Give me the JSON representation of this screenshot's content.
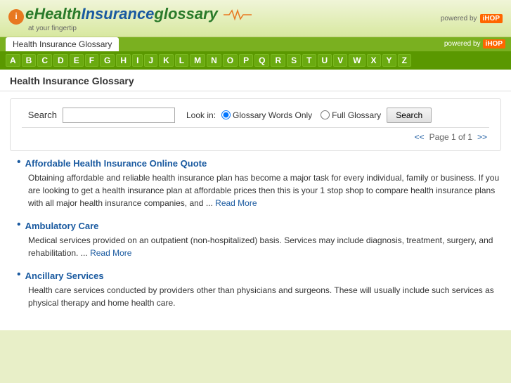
{
  "header": {
    "logo_e": "i",
    "logo_main": "eHealth",
    "logo_insurance": "Insurance",
    "logo_glossary": "glossary",
    "logo_tagline": "at your fingertip",
    "powered_by_label": "powered by",
    "powered_by_badge": "iHOP"
  },
  "nav": {
    "active_tab": "Health Insurance Glossary",
    "powered_by_right": "powered by",
    "powered_by_right_badge": "iHOP"
  },
  "alpha": {
    "letters": [
      "A",
      "B",
      "C",
      "D",
      "E",
      "F",
      "G",
      "H",
      "I",
      "J",
      "K",
      "L",
      "M",
      "N",
      "O",
      "P",
      "Q",
      "R",
      "S",
      "T",
      "U",
      "V",
      "W",
      "X",
      "Y",
      "Z"
    ]
  },
  "page_title": "Health Insurance Glossary",
  "search": {
    "label": "Search",
    "input_placeholder": "",
    "look_in_label": "Look in:",
    "option1_label": "Glossary Words Only",
    "option2_label": "Full Glossary",
    "button_label": "Search",
    "pagination_prev": "<<",
    "pagination_text": "Page 1 of 1",
    "pagination_next": ">>"
  },
  "results": [
    {
      "title": "Affordable Health Insurance Online Quote",
      "body": "Obtaining affordable and reliable health insurance plan has become a major task for every individual, family or business. If you are looking to get a health insurance plan at affordable prices then this is your 1 stop shop to compare health insurance plans with all major health insurance companies, and",
      "ellipsis": "...",
      "read_more": "Read More"
    },
    {
      "title": "Ambulatory Care",
      "body": "Medical services provided on an outpatient (non-hospitalized) basis. Services may include diagnosis, treatment, surgery, and rehabilitation.",
      "ellipsis": "...",
      "read_more": "Read More"
    },
    {
      "title": "Ancillary Services",
      "body": "Health care services conducted by providers other than physicians and surgeons. These will usually include such services as physical therapy and home health care.",
      "ellipsis": "",
      "read_more": ""
    }
  ]
}
